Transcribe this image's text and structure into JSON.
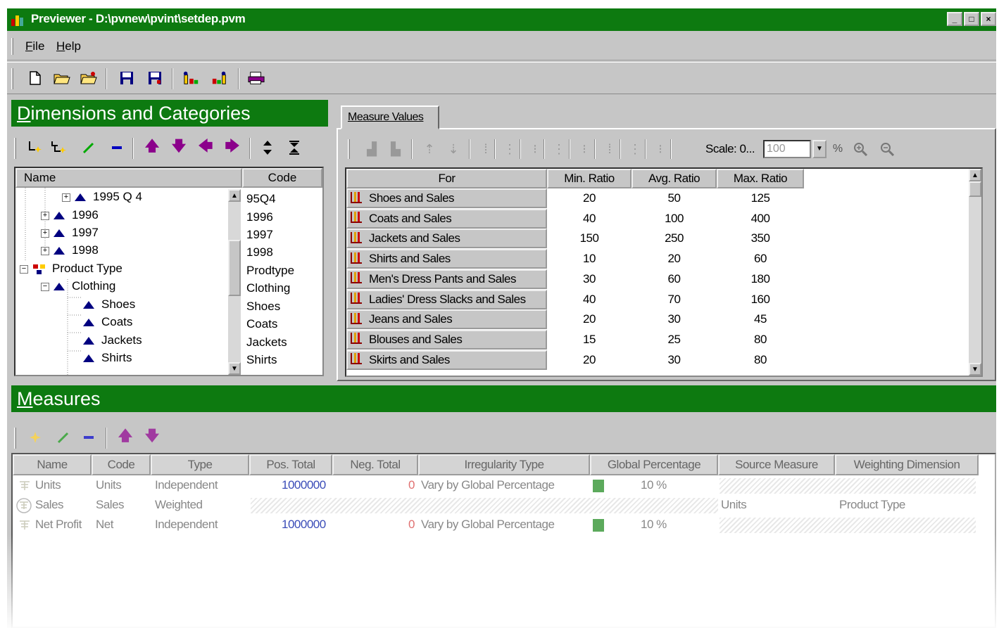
{
  "window": {
    "title": "Previewer - D:\\pvnew\\pvint\\setdep.pvm",
    "controls": [
      "_",
      "□",
      "×"
    ]
  },
  "menu": [
    {
      "mnemonic": "F",
      "rest": "ile"
    },
    {
      "mnemonic": "H",
      "rest": "elp"
    }
  ],
  "dimensions": {
    "heading_mnemonic": "D",
    "heading_rest": "imensions and Categories",
    "columns": {
      "name": "Name",
      "code": "Code"
    },
    "rows": [
      {
        "name": "1995 Q 4",
        "code": "95Q4"
      },
      {
        "name": "1996",
        "code": "1996"
      },
      {
        "name": "1997",
        "code": "1997"
      },
      {
        "name": "1998",
        "code": "1998"
      },
      {
        "name": "Product Type",
        "code": "Prodtype"
      },
      {
        "name": "Clothing",
        "code": "Clothing"
      },
      {
        "name": "Shoes",
        "code": "Shoes"
      },
      {
        "name": "Coats",
        "code": "Coats"
      },
      {
        "name": "Jackets",
        "code": "Jackets"
      },
      {
        "name": "Shirts",
        "code": "Shirts"
      }
    ]
  },
  "measure_values": {
    "tab_label": "Measure Values",
    "scale_label": "Scale: 0...",
    "scale_value": "100",
    "columns": {
      "for": "For",
      "min": "Min. Ratio",
      "avg": "Avg. Ratio",
      "max": "Max. Ratio"
    },
    "rows": [
      {
        "for": "Shoes and Sales",
        "min": "20",
        "avg": "50",
        "max": "125"
      },
      {
        "for": "Coats and Sales",
        "min": "40",
        "avg": "100",
        "max": "400"
      },
      {
        "for": "Jackets and Sales",
        "min": "150",
        "avg": "250",
        "max": "350"
      },
      {
        "for": "Shirts and Sales",
        "min": "10",
        "avg": "20",
        "max": "60"
      },
      {
        "for": "Men's Dress Pants and Sales",
        "min": "30",
        "avg": "60",
        "max": "180"
      },
      {
        "for": "Ladies' Dress Slacks and Sales",
        "min": "40",
        "avg": "70",
        "max": "160"
      },
      {
        "for": "Jeans and Sales",
        "min": "20",
        "avg": "30",
        "max": "45"
      },
      {
        "for": "Blouses and Sales",
        "min": "15",
        "avg": "25",
        "max": "80"
      },
      {
        "for": "Skirts and Sales",
        "min": "20",
        "avg": "30",
        "max": "80"
      }
    ]
  },
  "measures": {
    "heading_mnemonic": "M",
    "heading_rest": "easures",
    "columns": {
      "name": "Name",
      "code": "Code",
      "type": "Type",
      "pos_total": "Pos. Total",
      "neg_total": "Neg. Total",
      "irregularity": "Irregularity Type",
      "global_pct": "Global Percentage",
      "source": "Source Measure",
      "weighting": "Weighting Dimension"
    },
    "rows": [
      {
        "name": "Units",
        "code": "Units",
        "type": "Independent",
        "pos_total": "1000000",
        "neg_total": "0",
        "irregularity": "Vary by Global Percentage",
        "global_pct": "10 %",
        "source": "",
        "weighting": ""
      },
      {
        "name": "Sales",
        "code": "Sales",
        "type": "Weighted",
        "pos_total": "",
        "neg_total": "",
        "irregularity": "",
        "global_pct": "",
        "source": "Units",
        "weighting": "Product Type"
      },
      {
        "name": "Net Profit",
        "code": "Net",
        "type": "Independent",
        "pos_total": "1000000",
        "neg_total": "0",
        "irregularity": "Vary by Global Percentage",
        "global_pct": "10 %",
        "source": "",
        "weighting": ""
      }
    ]
  },
  "colors": {
    "title_green": "#0d7a10",
    "face": "#c6c6c6",
    "navy": "#000080",
    "purple": "#8b008b",
    "total_blue": "#3b4db8"
  }
}
